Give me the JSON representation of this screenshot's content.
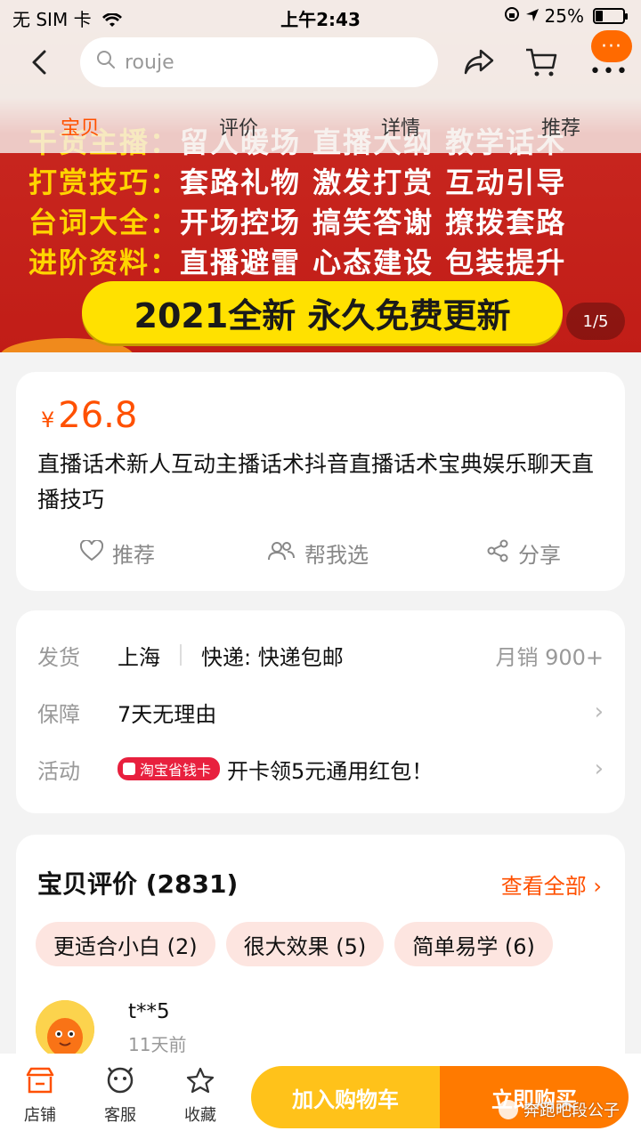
{
  "status_bar": {
    "carrier": "无 SIM 卡",
    "time": "上午2:43",
    "battery": "25%",
    "battery_level": 0.25
  },
  "search": {
    "placeholder": "rouje"
  },
  "nav": {
    "more_label": "···"
  },
  "tabs": [
    {
      "label": "宝贝"
    },
    {
      "label": "评价"
    },
    {
      "label": "详情"
    },
    {
      "label": "推荐"
    }
  ],
  "banner": {
    "lines": [
      {
        "key": "干货主播：",
        "value": "留人暖场 直播大纲 教学话术"
      },
      {
        "key": "打赏技巧：",
        "value": "套路礼物 激发打赏 互动引导"
      },
      {
        "key": "台词大全：",
        "value": "开场控场 搞笑答谢 撩拨套路"
      },
      {
        "key": "进阶资料：",
        "value": "直播避雷 心态建设 包装提升"
      }
    ],
    "slogan": "2021全新 永久免费更新",
    "page_indicator": "1/5"
  },
  "product": {
    "currency": "¥",
    "price": "26.8",
    "title": "直播话术新人互动主播话术抖音直播话术宝典娱乐聊天直播技巧",
    "actions": {
      "recommend": "推荐",
      "help_choose": "帮我选",
      "share": "分享"
    }
  },
  "shipping": {
    "ship_label": "发货",
    "ship_from": "上海",
    "express": "快递: 快递包邮",
    "monthly_sales": "月销 900+",
    "guarantee_label": "保障",
    "guarantee": "7天无理由",
    "promo_label": "活动",
    "promo_badge": "淘宝省钱卡",
    "promo_text": "开卡领5元通用红包！"
  },
  "reviews": {
    "header": "宝贝评价 (2831)",
    "view_all": "查看全部",
    "tags": [
      "更适合小白 (2)",
      "很大效果 (5)",
      "简单易学 (6)"
    ],
    "first": {
      "user": "t**5",
      "time": "11天前"
    }
  },
  "bottom_bar": {
    "shop": "店铺",
    "service": "客服",
    "favorite": "收藏",
    "add_to_cart": "加入购物车",
    "buy_now": "立即购买"
  },
  "watermark": "奔跑吧段公子",
  "colors": {
    "accent": "#ff5000",
    "cart_button": "#ffc21a",
    "buy_button": "#ff7a00",
    "badge": "#e8203e"
  }
}
